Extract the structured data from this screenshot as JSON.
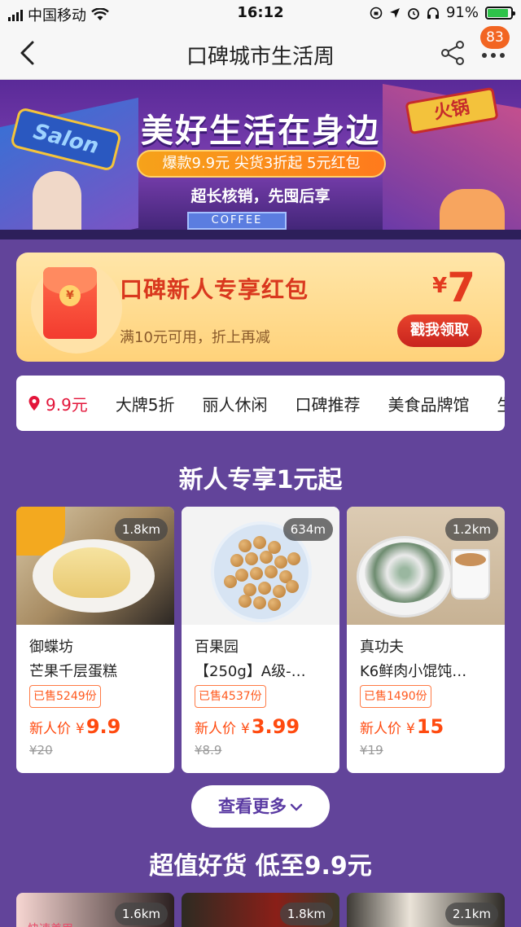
{
  "status_bar": {
    "carrier": "中国移动",
    "time": "16:12",
    "battery_percent": "91%",
    "battery_level": 0.91,
    "icons": [
      "signal-icon",
      "wifi-icon",
      "lock-rotation-icon",
      "location-arrow-icon",
      "alarm-icon",
      "headphones-icon",
      "battery-charging-icon"
    ]
  },
  "nav": {
    "title": "口碑城市生活周",
    "back_icon": "chevron-left-icon",
    "share_icon": "share-icon",
    "more_icon": "more-dots-icon",
    "badge_count": "83",
    "badge_color": "#f26522"
  },
  "banner": {
    "title": "美好生活在身边",
    "pill_text": "爆款9.9元  尖货3折起  5元红包",
    "subtitle": "超长核销，先囤后享",
    "sign_salon": "Salon",
    "sign_huoguo": "火锅",
    "sign_coffee": "COFFEE"
  },
  "coupon": {
    "title": "口碑新人专享红包",
    "desc": "满10元可用，折上再减",
    "currency": "¥",
    "amount": "7",
    "button_label": "戳我领取",
    "coin_symbol": "¥"
  },
  "tabs": [
    {
      "label": "9.9元",
      "active": true
    },
    {
      "label": "大牌5折",
      "active": false
    },
    {
      "label": "丽人休闲",
      "active": false
    },
    {
      "label": "口碑推荐",
      "active": false
    },
    {
      "label": "美食品牌馆",
      "active": false
    },
    {
      "label": "生",
      "active": false
    }
  ],
  "section_new_user": {
    "title": "新人专享1元起",
    "products": [
      {
        "distance": "1.8km",
        "shop": "御蝶坊",
        "name": "芒果千层蛋糕",
        "sold": "已售5249份",
        "price_label": "新人价",
        "currency": "¥",
        "price": "9.9",
        "original_price": "¥20"
      },
      {
        "distance": "634m",
        "shop": "百果园",
        "name": "【250g】A级-…",
        "sold": "已售4537份",
        "price_label": "新人价",
        "currency": "¥",
        "price": "3.99",
        "original_price": "¥8.9"
      },
      {
        "distance": "1.2km",
        "shop": "真功夫",
        "name": "K6鲜肉小馄饨…",
        "sold": "已售1490份",
        "price_label": "新人价",
        "currency": "¥",
        "price": "15",
        "original_price": "¥19"
      }
    ],
    "see_more_label": "查看更多"
  },
  "section_deals": {
    "title": "超值好货 低至9.9元",
    "products": [
      {
        "distance": "1.6km",
        "tag": "快速美甲"
      },
      {
        "distance": "1.8km"
      },
      {
        "distance": "2.1km"
      }
    ]
  },
  "colors": {
    "page_background": "#62449a",
    "accent_red": "#e3153a",
    "price_orange": "#ff4a0f",
    "coupon_red": "#d9381e"
  }
}
